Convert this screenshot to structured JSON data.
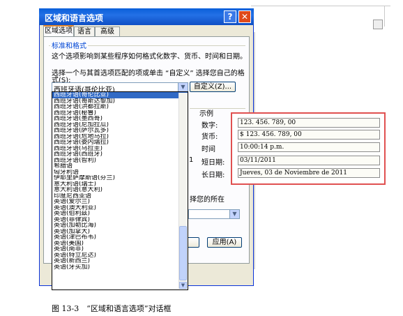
{
  "dialog": {
    "title": "区域和语言选项",
    "help_glyph": "?",
    "close_glyph": "✕",
    "tabs": [
      "区域选项",
      "语言",
      "高级"
    ]
  },
  "region": {
    "group_title": "标准和格式",
    "description": "这个选项影响到某些程序如何格式化数字、货币、时间和日期。",
    "instruction_line1": "选择一个与其首选项匹配的项或单击 “自定义” 选择您自己的格",
    "instruction_line2": "式(S):",
    "selected_value": "西班牙语(哥伦比亚)",
    "customize_button": "自定义(Z)...",
    "options": [
      "西班牙语(哥伦比亚)",
      "西班牙语(哥斯达黎加)",
      "西班牙语(洪都拉斯)",
      "西班牙语(秘鲁)",
      "西班牙语(墨西哥)",
      "西班牙语(尼加拉瓜)",
      "西班牙语(萨尔瓦多)",
      "西班牙语(危地马拉)",
      "西班牙语(委内瑞拉)",
      "西班牙语(乌拉圭)",
      "西班牙语(西班牙)",
      "西班牙语(智利)",
      "希腊语",
      "匈牙利语",
      "伊耶里萨摩斯语(芬兰)",
      "意大利语(瑞士)",
      "意大利语(意大利)",
      "印度尼西亚语",
      "英语(爱尔兰)",
      "英语(澳大利亚)",
      "英语(伯利兹)",
      "英语(菲律宾)",
      "英语(加勒比海)",
      "英语(加拿大)",
      "英语(津巴布韦)",
      "英语(美国)",
      "英语(南非)",
      "英语(特立尼达)",
      "英语(新西兰)",
      "英语(牙买加)"
    ]
  },
  "examples": {
    "heading": "示例",
    "number_label": "数字:",
    "currency_label": "货币:",
    "time_label": "时间",
    "short_date_label": "短日期:",
    "long_date_label": "长日期:",
    "partial_digit": "1",
    "number_value": "123. 456. 789, 00",
    "currency_value": "$ 123. 456. 789, 00",
    "time_value": "10:00:14 p.m.",
    "short_date_value": "03/11/2011",
    "long_date_value": "Jueves, 03 de Noviembre de 2011"
  },
  "location": {
    "text": "择您的所在"
  },
  "footer": {
    "apply_button": "应用(A)"
  },
  "caption": "图 13-3　“区域和语言选项”对话框"
}
